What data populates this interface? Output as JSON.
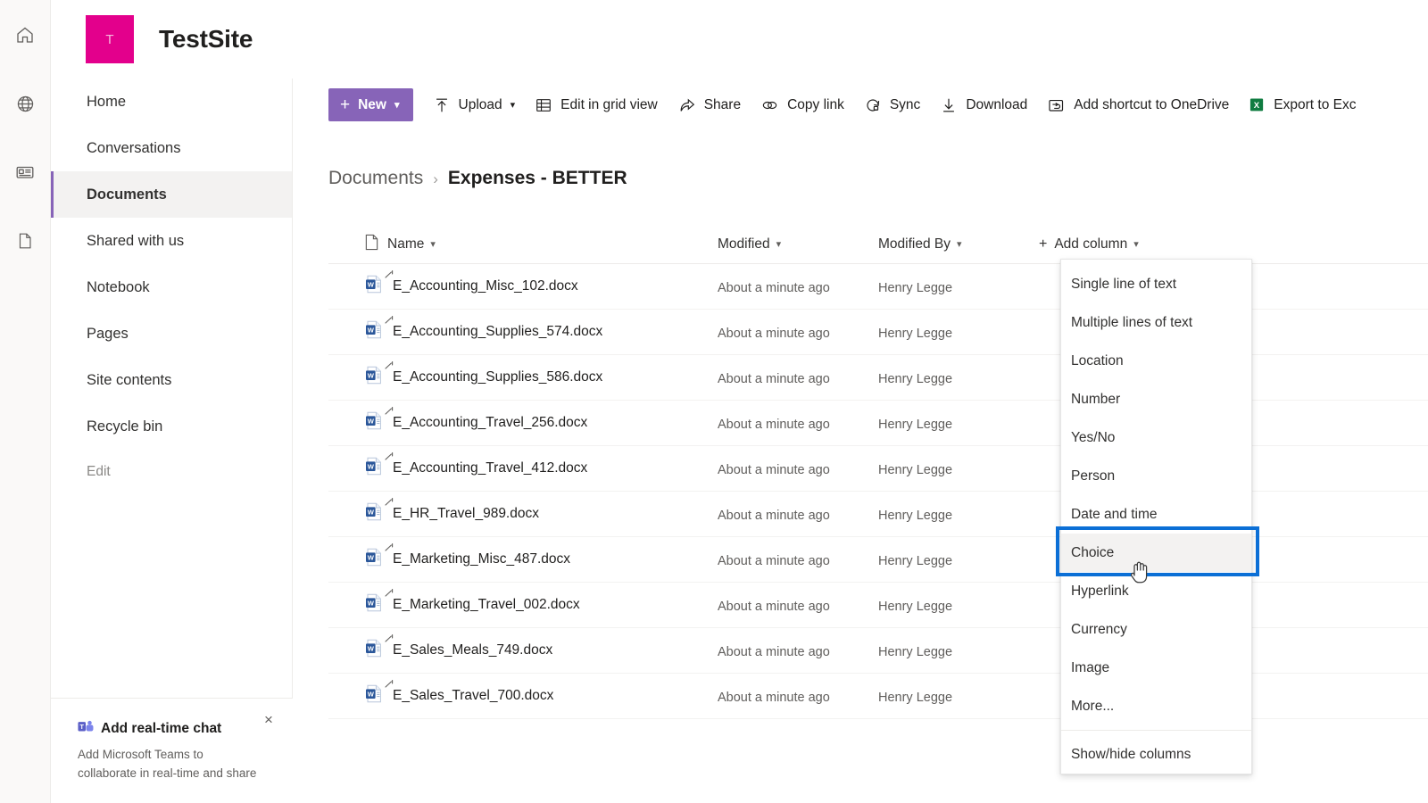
{
  "rail": {
    "items": [
      {
        "name": "home-icon",
        "label": "Home"
      },
      {
        "name": "globe-icon",
        "label": "My sites"
      },
      {
        "name": "news-icon",
        "label": "News"
      },
      {
        "name": "document-icon",
        "label": "Files"
      }
    ]
  },
  "site": {
    "logo_letter": "T",
    "logo_color": "#e3008c",
    "title": "TestSite"
  },
  "nav": {
    "items": [
      {
        "label": "Home",
        "active": false
      },
      {
        "label": "Conversations",
        "active": false
      },
      {
        "label": "Documents",
        "active": true
      },
      {
        "label": "Shared with us",
        "active": false
      },
      {
        "label": "Notebook",
        "active": false
      },
      {
        "label": "Pages",
        "active": false
      },
      {
        "label": "Site contents",
        "active": false
      },
      {
        "label": "Recycle bin",
        "active": false
      }
    ],
    "edit_label": "Edit",
    "accent_color": "#8764b8"
  },
  "promo": {
    "title": "Add real-time chat",
    "body": "Add Microsoft Teams to collaborate in real-time and share",
    "close_label": "×"
  },
  "toolbar": {
    "new_label": "New",
    "commands": [
      {
        "label": "Upload",
        "icon": "upload-icon",
        "has_chevron": true
      },
      {
        "label": "Edit in grid view",
        "icon": "grid-icon",
        "has_chevron": false
      },
      {
        "label": "Share",
        "icon": "share-icon",
        "has_chevron": false
      },
      {
        "label": "Copy link",
        "icon": "link-icon",
        "has_chevron": false
      },
      {
        "label": "Sync",
        "icon": "sync-icon",
        "has_chevron": false
      },
      {
        "label": "Download",
        "icon": "download-icon",
        "has_chevron": false
      },
      {
        "label": "Add shortcut to OneDrive",
        "icon": "onedrive-shortcut-icon",
        "has_chevron": false
      },
      {
        "label": "Export to Exc",
        "icon": "excel-icon",
        "has_chevron": false
      }
    ],
    "new_button_color": "#8764b8"
  },
  "breadcrumb": {
    "parent": "Documents",
    "separator": "›",
    "current": "Expenses - BETTER"
  },
  "table": {
    "headers": {
      "icon": "",
      "name": "Name",
      "modified": "Modified",
      "modified_by": "Modified By",
      "add_column": "Add column",
      "add_column_plus": "+"
    },
    "rows": [
      {
        "name": "E_Accounting_Misc_102.docx",
        "modified": "About a minute ago",
        "modified_by": "Henry Legge"
      },
      {
        "name": "E_Accounting_Supplies_574.docx",
        "modified": "About a minute ago",
        "modified_by": "Henry Legge"
      },
      {
        "name": "E_Accounting_Supplies_586.docx",
        "modified": "About a minute ago",
        "modified_by": "Henry Legge"
      },
      {
        "name": "E_Accounting_Travel_256.docx",
        "modified": "About a minute ago",
        "modified_by": "Henry Legge"
      },
      {
        "name": "E_Accounting_Travel_412.docx",
        "modified": "About a minute ago",
        "modified_by": "Henry Legge"
      },
      {
        "name": "E_HR_Travel_989.docx",
        "modified": "About a minute ago",
        "modified_by": "Henry Legge"
      },
      {
        "name": "E_Marketing_Misc_487.docx",
        "modified": "About a minute ago",
        "modified_by": "Henry Legge"
      },
      {
        "name": "E_Marketing_Travel_002.docx",
        "modified": "About a minute ago",
        "modified_by": "Henry Legge"
      },
      {
        "name": "E_Sales_Meals_749.docx",
        "modified": "About a minute ago",
        "modified_by": "Henry Legge"
      },
      {
        "name": "E_Sales_Travel_700.docx",
        "modified": "About a minute ago",
        "modified_by": "Henry Legge"
      }
    ]
  },
  "add_column_menu": {
    "items": [
      {
        "label": "Single line of text",
        "hovered": false
      },
      {
        "label": "Multiple lines of text",
        "hovered": false
      },
      {
        "label": "Location",
        "hovered": false
      },
      {
        "label": "Number",
        "hovered": false
      },
      {
        "label": "Yes/No",
        "hovered": false
      },
      {
        "label": "Person",
        "hovered": false
      },
      {
        "label": "Date and time",
        "hovered": false
      },
      {
        "label": "Choice",
        "hovered": true
      },
      {
        "label": "Hyperlink",
        "hovered": false
      },
      {
        "label": "Currency",
        "hovered": false
      },
      {
        "label": "Image",
        "hovered": false
      },
      {
        "label": "More...",
        "hovered": false
      }
    ],
    "footer_label": "Show/hide columns",
    "focus_ring_color": "#0b6fd6"
  }
}
